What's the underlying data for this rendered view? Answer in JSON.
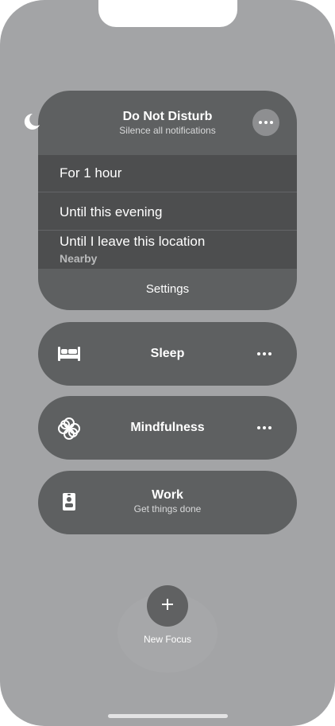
{
  "focus": {
    "dnd": {
      "title": "Do Not Disturb",
      "subtitle": "Silence all notifications",
      "icon": "moon-icon",
      "options": [
        {
          "label": "For 1 hour"
        },
        {
          "label": "Until this evening"
        },
        {
          "label": "Until I leave this location",
          "detail": "Nearby"
        }
      ],
      "settings_label": "Settings"
    },
    "modes": [
      {
        "title": "Sleep",
        "icon": "bed-icon"
      },
      {
        "title": "Mindfulness",
        "icon": "flower-icon"
      },
      {
        "title": "Work",
        "subtitle": "Get things done",
        "icon": "badge-icon"
      }
    ],
    "new_focus_label": "New Focus"
  }
}
